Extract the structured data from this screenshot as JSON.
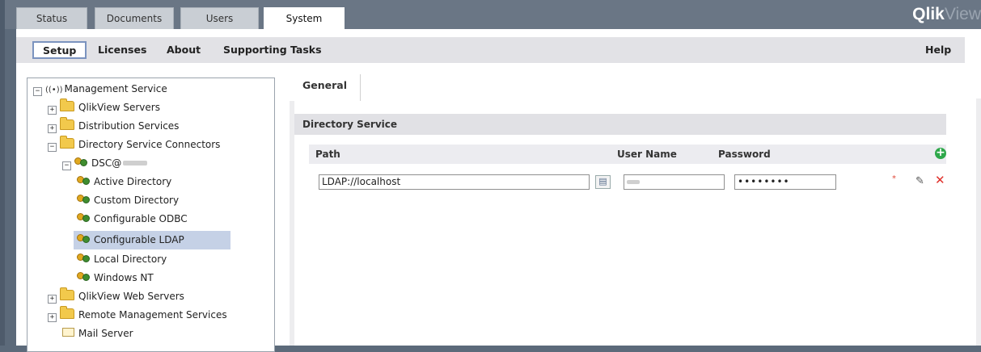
{
  "top_tabs": [
    "Status",
    "Documents",
    "Users",
    "System"
  ],
  "active_top_tab": "System",
  "logo": {
    "part1": "Qlik",
    "part2": "View"
  },
  "subnav": {
    "setup": "Setup",
    "licenses": "Licenses",
    "about": "About",
    "supporting": "Supporting Tasks",
    "help": "Help"
  },
  "tree": {
    "root": "Management Service",
    "qv_servers": "QlikView Servers",
    "distribution": "Distribution Services",
    "dsc": "Directory Service Connectors",
    "dsc_node": "DSC@",
    "active_directory": "Active Directory",
    "custom_directory": "Custom Directory",
    "configurable_odbc": "Configurable ODBC",
    "configurable_ldap": "Configurable LDAP",
    "local_directory": "Local Directory",
    "windows_nt": "Windows NT",
    "web_servers": "QlikView Web Servers",
    "remote_mgmt": "Remote Management Services",
    "mail_server": "Mail Server"
  },
  "panel": {
    "tab": "General",
    "section": "Directory Service",
    "columns": {
      "path": "Path",
      "user": "User Name",
      "password": "Password"
    },
    "row": {
      "path": "LDAP://localhost",
      "user": "",
      "password": "••••••••"
    },
    "required_mark": "*"
  }
}
